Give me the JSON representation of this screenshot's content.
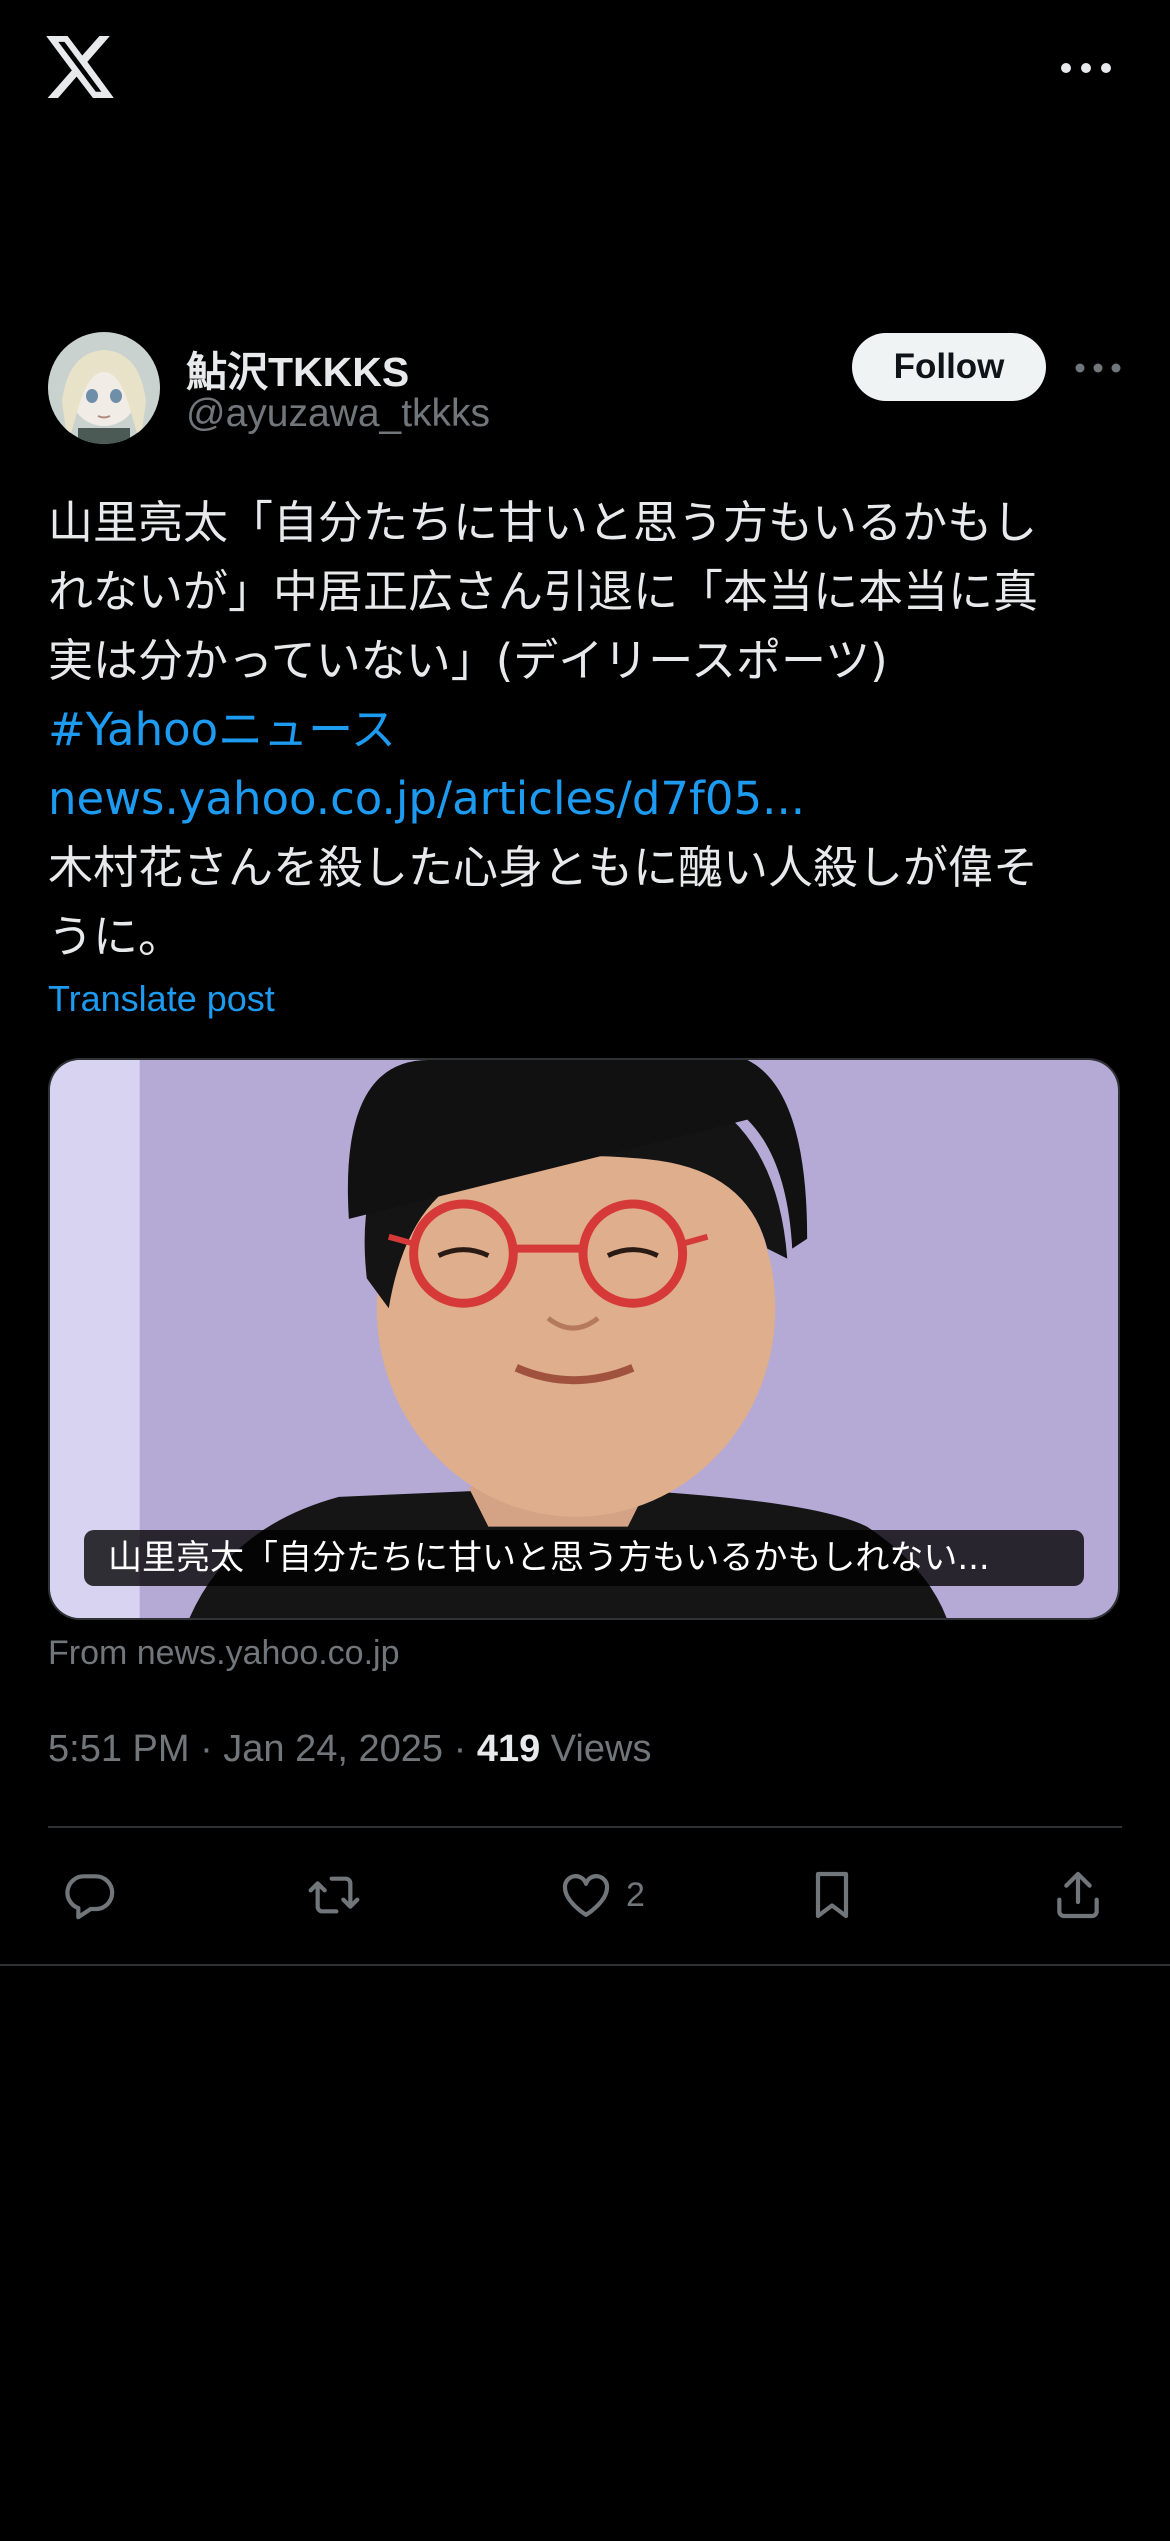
{
  "header": {
    "logo": "x-logo",
    "more_icon": "more-horizontal-icon"
  },
  "author": {
    "display_name": "鮎沢TKKKS",
    "handle": "@ayuzawa_tkkks",
    "follow_label": "Follow",
    "more_icon": "more-horizontal-icon"
  },
  "tweet": {
    "lines": [
      "山里亮太「自分たちに甘いと思う方もいるかもし",
      "れないが」中居正広さん引退に「本当に本当に真",
      "実は分かっていない」(デイリースポーツ)"
    ],
    "hashtag": "#Yahooニュース",
    "link": "news.yahoo.co.jp/articles/d7f05...",
    "comment_lines": [
      "木村花さんを殺した心身ともに醜い人殺しが偉そ",
      "うに。"
    ],
    "translate_label": "Translate post"
  },
  "card": {
    "caption": "山里亮太「自分たちに甘いと思う方もいるかもしれない...",
    "source": "From news.yahoo.co.jp"
  },
  "meta": {
    "time_date": "5:51 PM · Jan 24, 2025 · ",
    "views_count": "419",
    "views_label": " Views"
  },
  "actions": {
    "reply_icon": "reply-icon",
    "retweet_icon": "retweet-icon",
    "like_icon": "heart-icon",
    "like_count": "2",
    "bookmark_icon": "bookmark-icon",
    "share_icon": "share-icon"
  },
  "colors": {
    "background": "#000000",
    "text": "#e7e9ea",
    "muted": "#71767b",
    "link": "#1d9bf0",
    "divider": "#2f3336"
  }
}
